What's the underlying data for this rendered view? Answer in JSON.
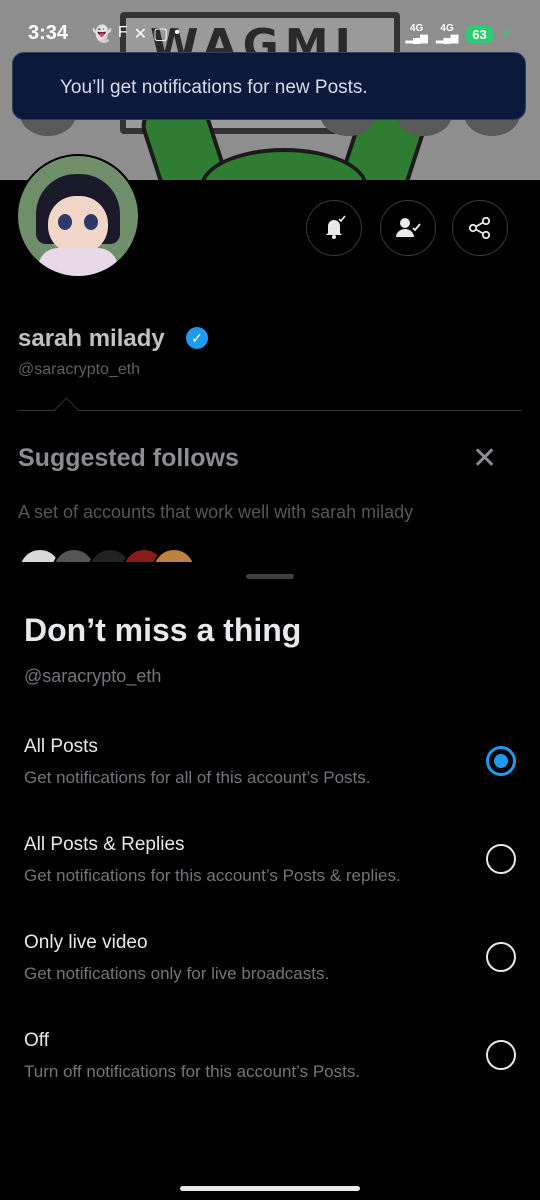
{
  "status_bar": {
    "time": "3:34",
    "network_1": "4G",
    "network_2": "4G",
    "battery": "63"
  },
  "banner": {
    "sign_text": "WAGMI"
  },
  "toast": {
    "message": "You’ll get notifications for new Posts."
  },
  "profile": {
    "display_name": "sarah milady",
    "handle": "@saracrypto_eth",
    "verified": true
  },
  "suggested": {
    "title": "Suggested follows",
    "description": "A set of accounts that work well with sarah milady"
  },
  "sheet": {
    "title": "Don’t miss a thing",
    "handle": "@saracrypto_eth",
    "options": [
      {
        "title": "All Posts",
        "description": "Get notifications for all of this account’s Posts.",
        "selected": true
      },
      {
        "title": "All Posts & Replies",
        "description": "Get notifications for this account’s Posts & replies.",
        "selected": false
      },
      {
        "title": "Only live video",
        "description": "Get notifications only for live broadcasts.",
        "selected": false
      },
      {
        "title": "Off",
        "description": "Turn off notifications for this account’s Posts.",
        "selected": false
      }
    ]
  },
  "colors": {
    "accent": "#1d9bf0",
    "background": "#000000",
    "toast_bg": "#0b1a3a"
  },
  "icons": [
    "notification-bell-check-icon",
    "following-person-check-icon",
    "share-icon",
    "close-icon",
    "verified-badge-icon"
  ]
}
